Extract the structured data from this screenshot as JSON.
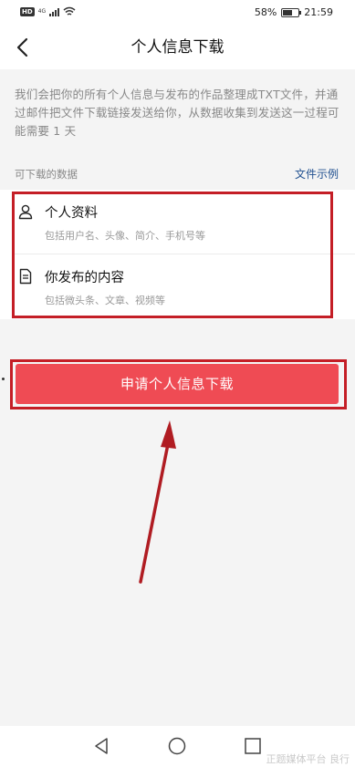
{
  "status_bar": {
    "hd": "HD",
    "network": "4G",
    "battery": "58%",
    "battery_level": 0.58,
    "time": "21:59"
  },
  "nav": {
    "title": "个人信息下载",
    "back_icon": "chevron-left-icon"
  },
  "description": "我们会把你的所有个人信息与发布的作品整理成TXT文件，并通过邮件把文件下载链接发送给你，从数据收集到发送这一过程可能需要 1 天",
  "section": {
    "title": "可下载的数据",
    "link": "文件示例"
  },
  "data_items": [
    {
      "icon": "user-icon",
      "title": "个人资料",
      "subtitle": "包括用户名、头像、简介、手机号等"
    },
    {
      "icon": "document-icon",
      "title": "你发布的内容",
      "subtitle": "包括微头条、文章、视频等"
    }
  ],
  "apply_button": "申请个人信息下载",
  "bottom_nav": {
    "back": "triangle-back-icon",
    "home": "circle-home-icon",
    "recent": "square-recent-icon"
  },
  "watermark": "正题媒体平台 良行",
  "colors": {
    "accent": "#ef4b54",
    "highlight": "#c41e26",
    "link": "#1f4f8f"
  }
}
